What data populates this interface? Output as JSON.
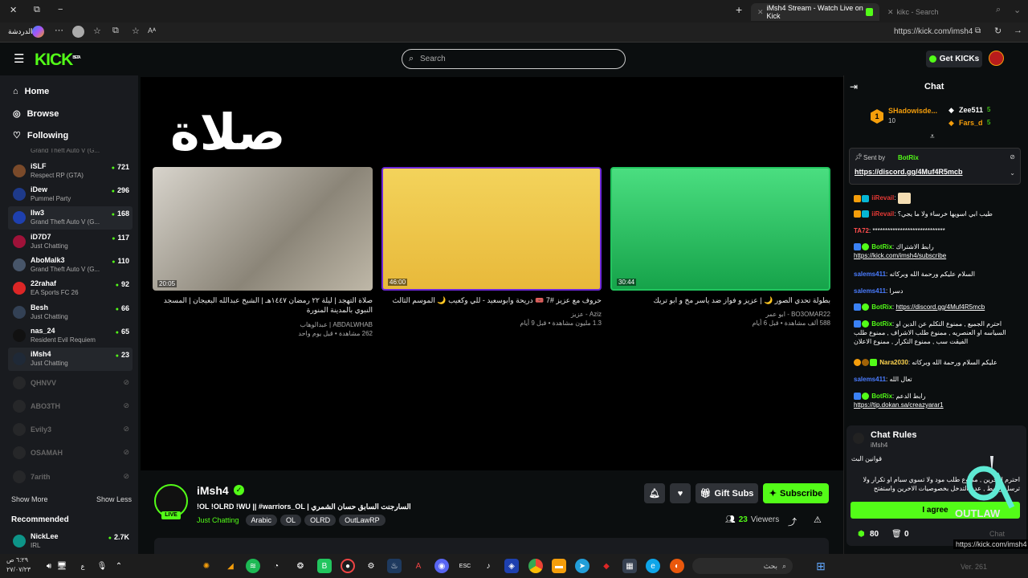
{
  "browser": {
    "tabs": [
      {
        "label": "iMsh4 Stream - Watch Live on Kick",
        "active": true
      },
      {
        "label": "kikc - Search",
        "active": false
      }
    ],
    "url": "https://kick.com/imsh4",
    "left_label": "الدردشة",
    "status_url": "https://kick.com/imsh4"
  },
  "header": {
    "logo": "KICK",
    "logo_sup": "BETA",
    "search_placeholder": "Search",
    "get_kicks": "Get KICKs"
  },
  "sidebar": {
    "nav": [
      {
        "label": "Home",
        "icon": "home-icon"
      },
      {
        "label": "Browse",
        "icon": "compass-icon"
      },
      {
        "label": "Following",
        "icon": "heart-icon"
      }
    ],
    "partial_game": "Grand Theft Auto V (G...",
    "channels": [
      {
        "name": "iSLF",
        "game": "Respect RP (GTA)",
        "viewers": "721"
      },
      {
        "name": "iDew",
        "game": "Pummel Party",
        "viewers": "296"
      },
      {
        "name": "llw3",
        "game": "Grand Theft Auto V (G...",
        "viewers": "168"
      },
      {
        "name": "iD7D7",
        "game": "Just Chatting",
        "viewers": "117"
      },
      {
        "name": "AboMalk3",
        "game": "Grand Theft Auto V (G...",
        "viewers": "110"
      },
      {
        "name": "22rahaf",
        "game": "EA Sports FC 26",
        "viewers": "92"
      },
      {
        "name": "Besh",
        "game": "Just Chatting",
        "viewers": "66"
      },
      {
        "name": "nas_24",
        "game": "Resident Evil Requiem",
        "viewers": "65"
      },
      {
        "name": "iMsh4",
        "game": "Just Chatting",
        "viewers": "23"
      }
    ],
    "offline": [
      "QHNVV",
      "ABO3TH",
      "Evily3",
      "OSAMAH",
      "7arith"
    ],
    "show_more": "Show More",
    "show_less": "Show Less",
    "recommended_title": "Recommended",
    "recommended": [
      {
        "name": "NickLee",
        "game": "IRL",
        "viewers": "2.7K"
      }
    ]
  },
  "player": {
    "overlay_text": "صلاة",
    "videos": [
      {
        "duration": "20:05",
        "title": "صلاة التهجد | ليلة ٢٢ رمضان ١٤٤٧هـ | الشيخ عبدالله البعيجان | المسجد النبوي بالمدينة المنورة",
        "channel": "ABDALWHAB | عبدالوهاب",
        "meta": "262 مشاهدة • قبل يوم واحد"
      },
      {
        "duration": "46:00",
        "title": "حروف مع عزيز #7 🎟️ دريحة وابوسعيد - للي وكعيب 🌙 الموسم الثالث",
        "channel": "Aziz - عزيز",
        "meta": "1.3 مليون مشاهدة • قبل 9 أيام"
      },
      {
        "duration": "30:44",
        "title": "بطولة تحدي الصور 🌙 | عزيز و فواز ضد ياسر مخ و ابو تريك",
        "channel": "BO3OMAR22 - ابو عمر",
        "meta": "588 ألف مشاهدة • قبل 6 أيام"
      }
    ]
  },
  "stream": {
    "streamer": "iMsh4",
    "live_label": "LIVE",
    "title": "!OL !OLRD !WU || #warriors_OL |  السارجنت السابق حسان الشمري",
    "category": "Just Chatting",
    "tags": [
      "Arabic",
      "OL",
      "OLRD",
      "OutLawRP"
    ],
    "viewers": "23",
    "viewers_label": "Viewers",
    "gift_subs": "Gift Subs",
    "subscribe": "Subscribe"
  },
  "chat": {
    "title": "Chat",
    "gifters": [
      {
        "rank": "1",
        "name": "SHadowisde...",
        "count": "10"
      },
      {
        "name": "Zee511",
        "count": "5"
      },
      {
        "name": "Fars_d",
        "count": "5"
      }
    ],
    "pinned_by_label": "Sent by",
    "pinned_by": "BotRix",
    "pinned_link": "https://discord.gg/4Muf4R5mcb",
    "messages": [
      {
        "user": "iiRevail",
        "color": "#e53935",
        "text": ":"
      },
      {
        "user": "iiRevail",
        "color": "#e53935",
        "text": ": طيب ابي اسويها خرساء ولا ما يجي؟"
      },
      {
        "user": "TA72",
        "color": "#ff4d4d",
        "text": ": *****************************"
      },
      {
        "user": "BotRix",
        "color": "#53fc18",
        "text": ": رابط الاشتراك",
        "link": "https://kick.com/imsh4/subscribe"
      },
      {
        "user": "salems411",
        "color": "#4a7cff",
        "text": ": السلام عليكم ورحمة الله وبركاته"
      },
      {
        "user": "salems411",
        "color": "#4a7cff",
        "text": ": دسرا"
      },
      {
        "user": "BotRix",
        "color": "#53fc18",
        "text": ": ",
        "link": "https://discord.gg/4Muf4R5mcb"
      },
      {
        "user": "BotRix",
        "color": "#53fc18",
        "text": ": احترم الجميع , ممنوع التكلم عن الدين او السياسه او العنصريه , ممنوع طلب الاشراف , ممنوع طلب الفيقت سب , ممنوع التكرار , ممنوع الاعلان"
      },
      {
        "user": "Nara2030",
        "color": "#ffd54f",
        "text": ": عليكم السلام ورحمة الله وبركاته"
      },
      {
        "user": "salems411",
        "color": "#4a7cff",
        "text": ": تعال الله"
      },
      {
        "user": "BotRix",
        "color": "#53fc18",
        "text": ": رابط الدعم",
        "link": "https://tip.dokan.sa/creazyarar1"
      }
    ],
    "rules_title": "Chat Rules",
    "rules_user": "iMsh4",
    "rules_heading": "قوانين البث",
    "rules_text": "احترم الاخرين , ممنوع طلب مود ولا تسوي سبام او تكرار ولا ترسل روابط , عدم التدخل بخصوصيات الاخرين واستفتح",
    "agree": "I agree",
    "points": "80",
    "other_count": "0",
    "send_label": "Chat"
  },
  "taskbar": {
    "time": "٦:٢٩ ص",
    "date": "٢٧/٠٧/٢٣",
    "search_label": "بحث",
    "version_text": "Ver. 261"
  },
  "colors": {
    "accent": "#53fc18",
    "bg": "#0b0e0f",
    "sidebar": "#191b1f"
  }
}
